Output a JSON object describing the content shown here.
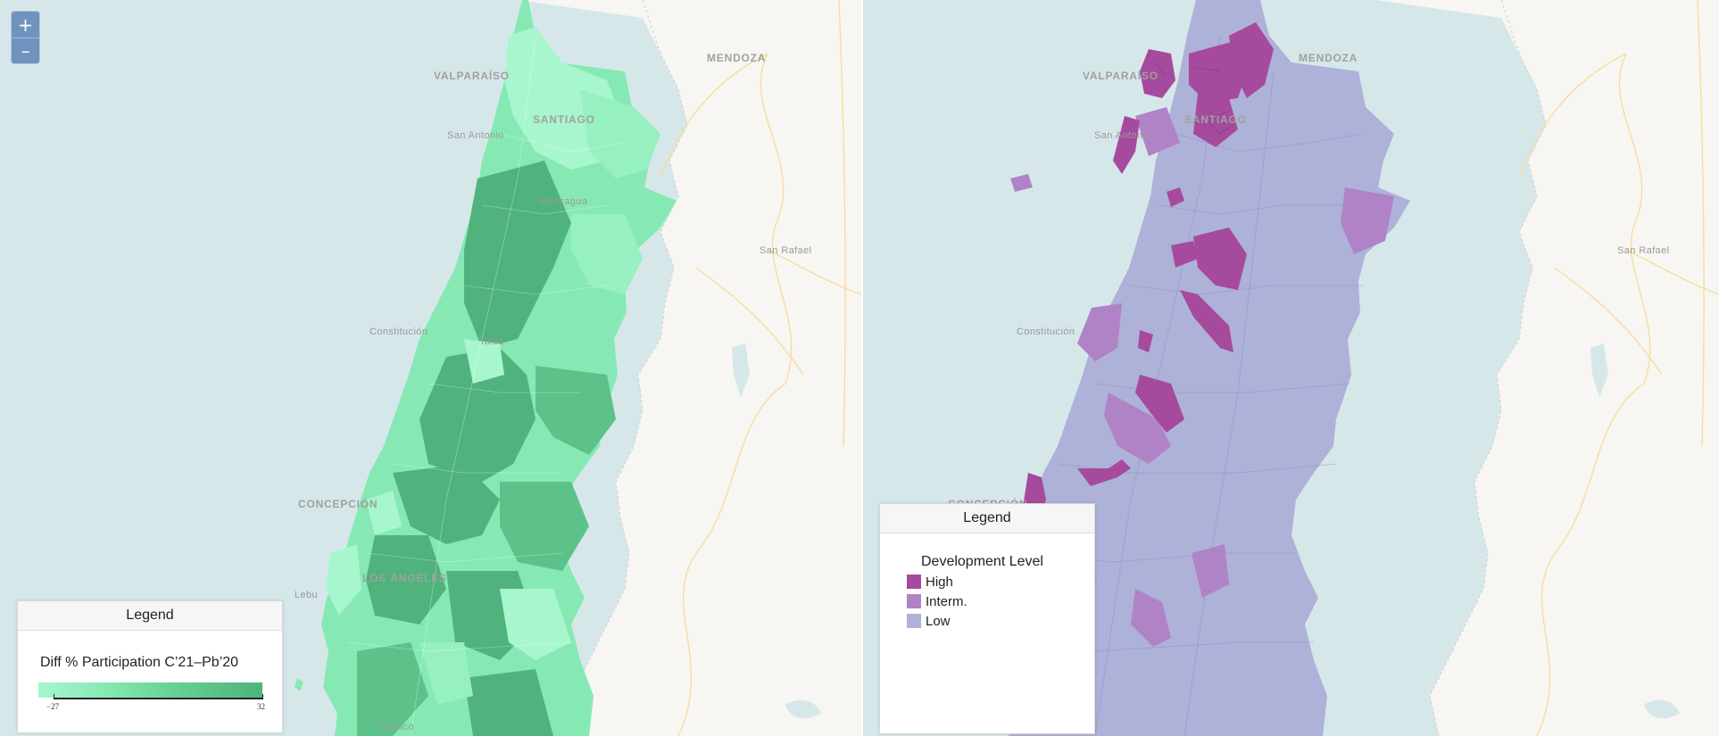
{
  "map_controls": {
    "zoom_in": "+",
    "zoom_out": "–"
  },
  "cities": {
    "valparaiso": "VALPARAÍSO",
    "mendoza": "MENDOZA",
    "santiago": "SANTIAGO",
    "san_antonio": "San Antonio",
    "san_rafael": "San Rafael",
    "constitucion": "Constitución",
    "concepcion": "CONCEPCIÓN",
    "los_angeles": "LOS ÁNGELES",
    "lebu": "Lebu",
    "temuco": "Temuco",
    "rancagua": "Rancagua",
    "talca": "Talca"
  },
  "left_map": {
    "legend": {
      "header": "Legend",
      "title": "Diff % Participation C’21–Pb’20",
      "min_label": "−27",
      "max_label": "32",
      "color_low": "#a7f6ce",
      "color_high": "#50b27d"
    }
  },
  "right_map": {
    "legend": {
      "header": "Legend",
      "title": "Development Level",
      "categories": [
        {
          "label": "High",
          "color": "#a64a9e"
        },
        {
          "label": "Interm.",
          "color": "#b083c6"
        },
        {
          "label": "Low",
          "color": "#aeb1d8"
        }
      ]
    }
  },
  "colors": {
    "sea": "#d6e7ea",
    "land": "#f7f6f2",
    "road": "#f8dca0",
    "border": "#c9c9c9"
  }
}
